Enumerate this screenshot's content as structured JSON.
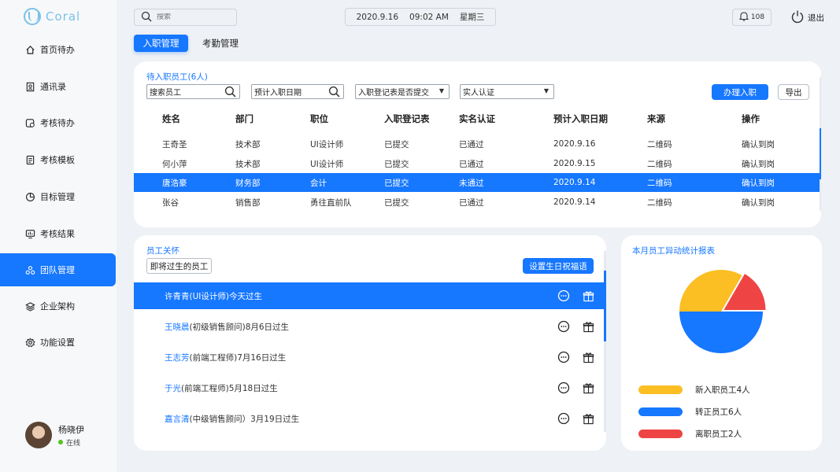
{
  "app": {
    "name": "Coral"
  },
  "colors": {
    "primary": "#1677ff",
    "yellow": "#fbbf24",
    "red": "#ef4444"
  },
  "sidebar": {
    "items": [
      {
        "label": "首页待办",
        "icon": "home-icon"
      },
      {
        "label": "通讯录",
        "icon": "contacts-icon"
      },
      {
        "label": "考核待办",
        "icon": "review-todo-icon"
      },
      {
        "label": "考核模板",
        "icon": "template-icon"
      },
      {
        "label": "目标管理",
        "icon": "target-icon"
      },
      {
        "label": "考核结果",
        "icon": "result-icon"
      },
      {
        "label": "团队管理",
        "icon": "team-icon",
        "active": true
      },
      {
        "label": "企业架构",
        "icon": "layers-icon"
      },
      {
        "label": "功能设置",
        "icon": "gear-icon"
      }
    ],
    "user": {
      "name": "杨晓伊",
      "status": "在线"
    }
  },
  "topbar": {
    "search_placeholder": "搜索",
    "date": "2020.9.16",
    "time": "09:02 AM",
    "weekday": "星期三",
    "notifications": "108",
    "logout": "退出"
  },
  "tabs": [
    "入职管理",
    "考勤管理"
  ],
  "onboarding": {
    "title": "待入职员工(6人)",
    "filters": {
      "employee_search": "搜索员工",
      "date_search": "预计入职日期",
      "form_status": "入职登记表是否提交",
      "real_name": "实人认证"
    },
    "actions": {
      "onboard": "办理入职",
      "export": "导出"
    },
    "columns": [
      "姓名",
      "部门",
      "职位",
      "入职登记表",
      "实名认证",
      "预计入职日期",
      "来源",
      "操作"
    ],
    "rows": [
      {
        "name": "王奇圣",
        "dept": "技术部",
        "position": "UI设计师",
        "form": "已提交",
        "verify": "已通过",
        "date": "2020.9.16",
        "source": "二维码",
        "action": "确认到岗"
      },
      {
        "name": "何小萍",
        "dept": "技术部",
        "position": "UI设计师",
        "form": "已提交",
        "verify": "已通过",
        "date": "2020.9.15",
        "source": "二维码",
        "action": "确认到岗"
      },
      {
        "name": "唐浩豪",
        "dept": "财务部",
        "position": "会计",
        "form": "已提交",
        "verify": "未通过",
        "date": "2020.9.14",
        "source": "二维码",
        "action": "确认到岗",
        "selected": true
      },
      {
        "name": "张谷",
        "dept": "销售部",
        "position": "勇往直前队",
        "form": "已提交",
        "verify": "已通过",
        "date": "2020.9.14",
        "source": "二维码",
        "action": "确认到岗"
      }
    ]
  },
  "care": {
    "title": "员工关怀",
    "tag": "即将过生的员工",
    "greeting_button": "设置生日祝福语",
    "rows": [
      {
        "name": "许青青",
        "detail": "(UI设计师)今天过生",
        "selected": true
      },
      {
        "name": "王晓晨",
        "detail": "(初级销售顾问)8月6日过生"
      },
      {
        "name": "王志芳",
        "detail": "(前端工程师)7月16日过生"
      },
      {
        "name": "于光",
        "detail": "(前端工程师)5月18日过生"
      },
      {
        "name": "嘉言清",
        "detail": "(中级销售顾问）3月19日过生"
      }
    ]
  },
  "stats": {
    "title": "本月员工异动统计报表",
    "chart_data": {
      "type": "pie",
      "slices": [
        {
          "label": "新入职员工4人",
          "value": 4,
          "color": "#fbbf24"
        },
        {
          "label": "转正员工6人",
          "value": 6,
          "color": "#1677ff"
        },
        {
          "label": "离职员工2人",
          "value": 2,
          "color": "#ef4444"
        }
      ]
    }
  }
}
